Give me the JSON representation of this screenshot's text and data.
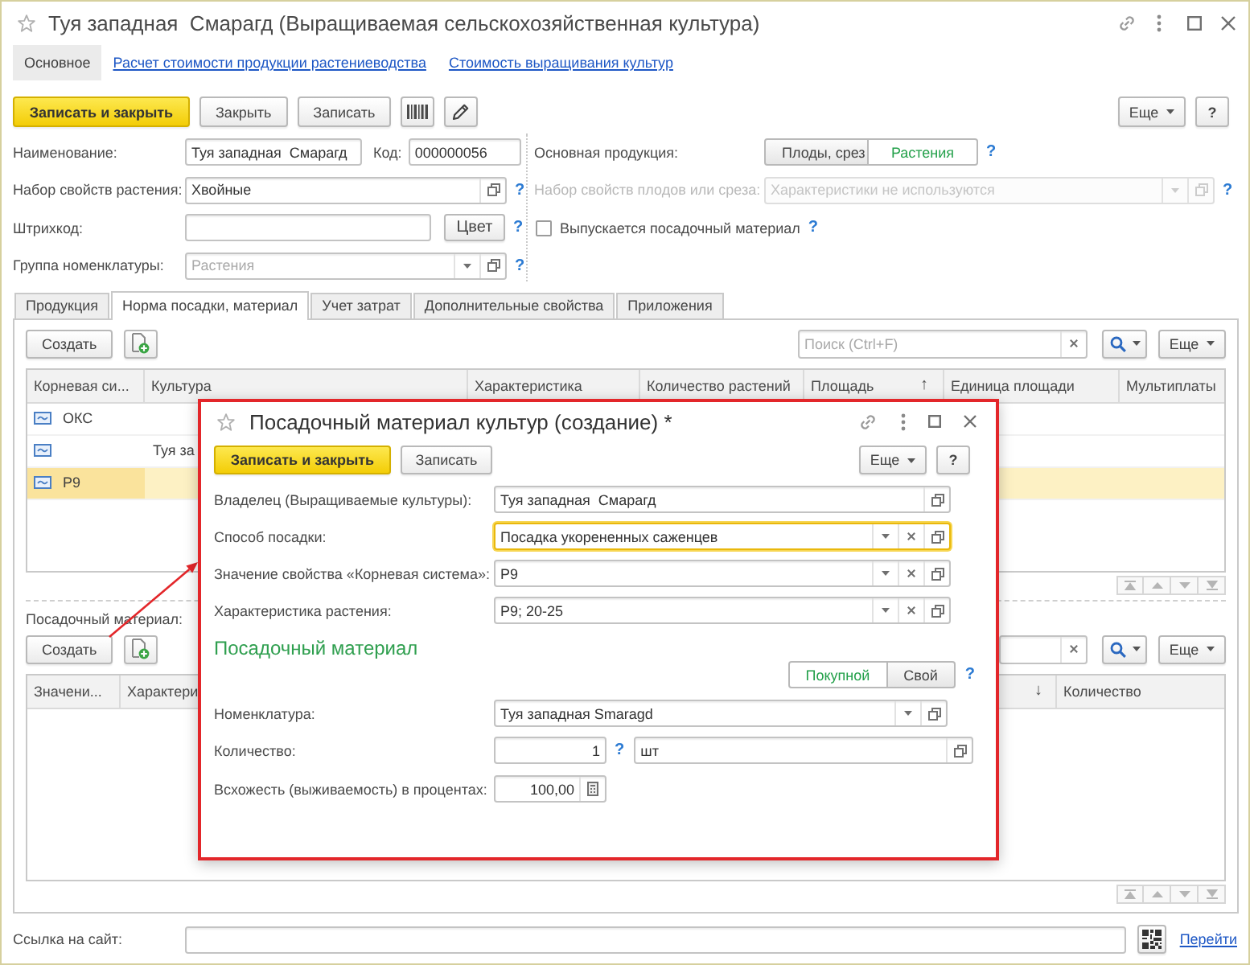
{
  "window": {
    "title": "Туя западная  Смарагд (Выращиваемая сельскохозяйственная культура)"
  },
  "nav": [
    {
      "label": "Основное",
      "selected": true
    },
    {
      "label": "Расчет стоимости продукции растениеводства",
      "selected": false
    },
    {
      "label": "Стоимость выращивания культур",
      "selected": false
    }
  ],
  "toolbar": {
    "buttons": [
      {
        "kind": "primary",
        "label": "Записать и закрыть"
      },
      {
        "kind": "plain",
        "label": "Закрыть"
      },
      {
        "kind": "plain",
        "label": "Записать"
      },
      {
        "kind": "barcode"
      },
      {
        "kind": "tool"
      }
    ],
    "more": "Еще",
    "help": "?"
  },
  "form": {
    "name": {
      "label": "Наименование:",
      "value": "Туя западная  Смарагд"
    },
    "code": {
      "label": "Код:",
      "value": "000000056"
    },
    "plant_properties": {
      "label": "Набор свойств растения:",
      "value": "Хвойные",
      "help": "?"
    },
    "barcode": {
      "label": "Штрихкод:",
      "button": "Цвет",
      "help": "?"
    },
    "item_group": {
      "label": "Группа номенклатуры:",
      "placeholder": "Растения",
      "help": "?"
    },
    "main_product": {
      "label": "Основная продукция:",
      "options": [
        {
          "label": "Плоды, срез",
          "selected": false
        },
        {
          "label": "Растения",
          "selected": true
        }
      ],
      "help": "?"
    },
    "fruit_properties": {
      "label": "Набор свойств плодов или среза:",
      "placeholder": "Характеристики не используются",
      "disabled": true,
      "help": "?"
    },
    "planting_material": {
      "label": "Выпускается посадочный материал",
      "checked": false,
      "help": "?"
    }
  },
  "tabs": [
    {
      "label": "Продукция",
      "selected": false
    },
    {
      "label": "Норма посадки, материал",
      "selected": true
    },
    {
      "label": "Учет затрат",
      "selected": false
    },
    {
      "label": "Дополнительные свойства",
      "selected": false
    },
    {
      "label": "Приложения",
      "selected": false
    }
  ],
  "norms": {
    "create": "Создать",
    "search": {
      "placeholder": "Поиск (Ctrl+F)"
    },
    "more": "Еще",
    "columns": [
      {
        "label": "Корневая си..."
      },
      {
        "label": "Культура"
      },
      {
        "label": "Характеристика"
      },
      {
        "label": "Количество растений"
      },
      {
        "label": "Площадь",
        "sort": "↑"
      },
      {
        "label": "Единица площади"
      },
      {
        "label": "Мультиплаты"
      }
    ],
    "rows": [
      {
        "root_system": "ОКС",
        "selected": false
      },
      {
        "culture": "Туя за",
        "selected": false
      },
      {
        "root_system": "Р9",
        "selected": true
      }
    ]
  },
  "materials": {
    "label": "Посадочный материал:",
    "create": "Создать",
    "more": "Еще",
    "columns": [
      {
        "label": "Значени..."
      },
      {
        "label": "Характери"
      },
      {
        "sort": "↓"
      },
      {
        "label": "Количество"
      }
    ]
  },
  "site_link": {
    "label": "Ссылка на сайт:",
    "link": "Перейти"
  },
  "dialog": {
    "title": "Посадочный материал культур (создание) *",
    "buttons": [
      {
        "kind": "primary",
        "label": "Записать и закрыть"
      },
      {
        "kind": "plain",
        "label": "Записать"
      }
    ],
    "more": "Еще",
    "help": "?",
    "fields": [
      {
        "kind": "reference",
        "label": "Владелец (Выращиваемые культуры):",
        "value": "Туя западная  Смарагд",
        "focused": false
      },
      {
        "kind": "choice",
        "label": "Способ посадки:",
        "value": "Посадка укорененных саженцев",
        "focused": true
      },
      {
        "kind": "choice",
        "label": "Значение свойства «Корневая система»:",
        "value": "Р9",
        "focused": false
      },
      {
        "kind": "choice",
        "label": "Характеристика растения:",
        "value": "Р9; 20-25",
        "focused": false
      }
    ],
    "section": "Посадочный материал",
    "source": {
      "options": [
        {
          "label": "Покупной",
          "selected": true
        },
        {
          "label": "Свой",
          "selected": false
        }
      ],
      "help": "?"
    },
    "item": {
      "label": "Номенклатура:",
      "value": "Туя западная Smaragd"
    },
    "quantity": {
      "label": "Количество:",
      "value": "1",
      "help": "?",
      "unit": "шт"
    },
    "germination": {
      "label": "Всхожесть (выживаемость) в процентах:",
      "value": "100,00"
    }
  }
}
